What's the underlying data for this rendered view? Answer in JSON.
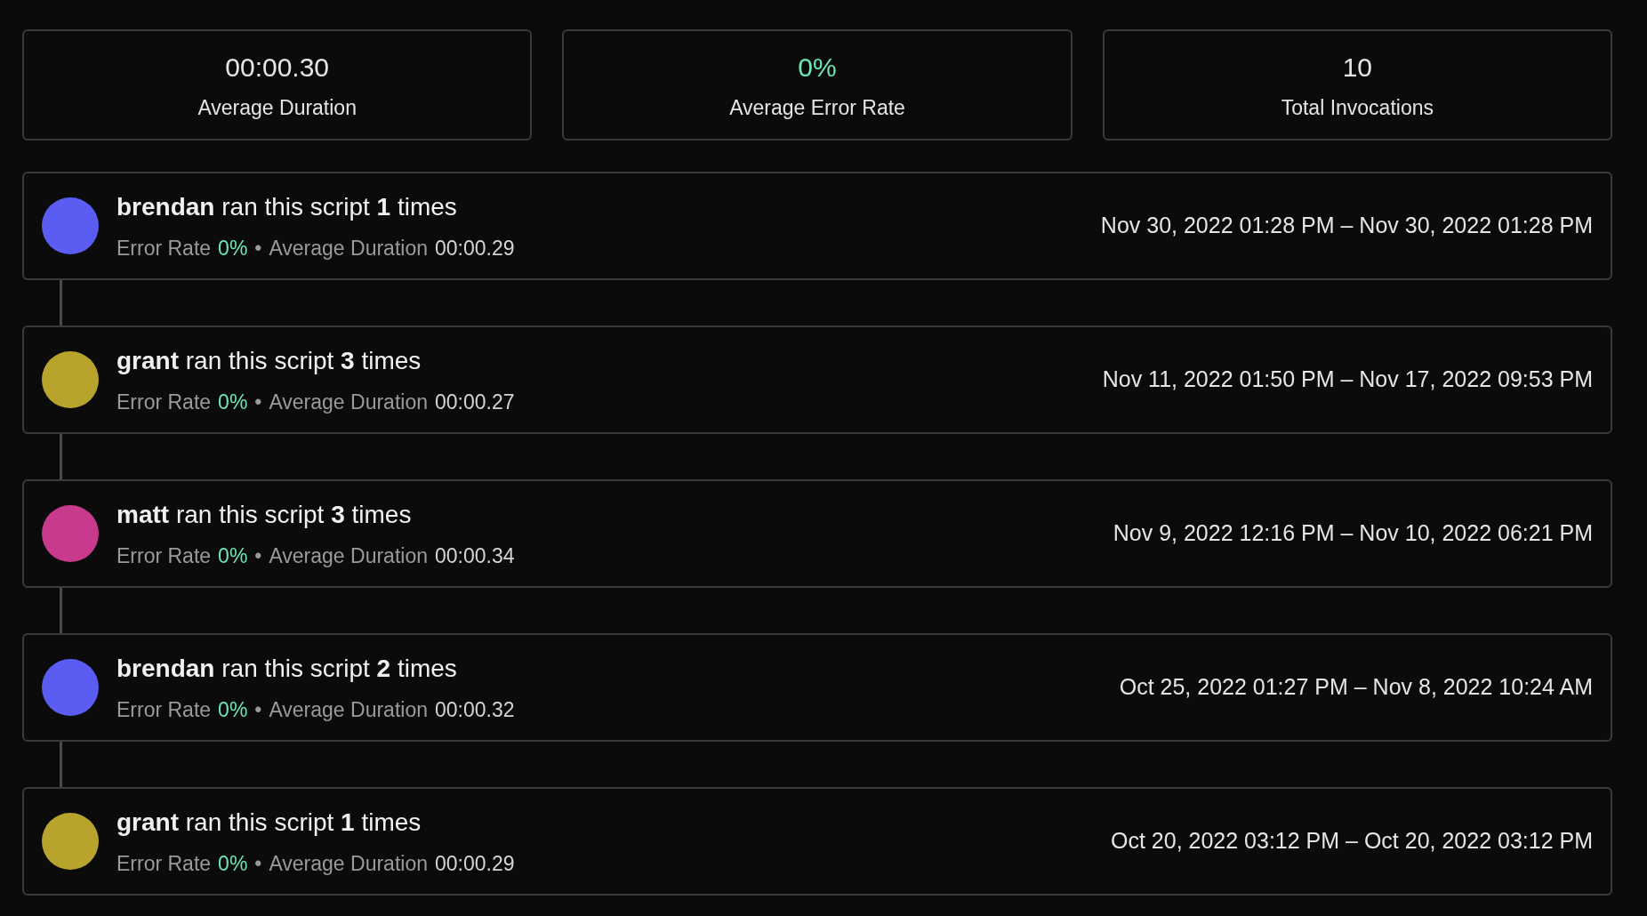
{
  "stats": [
    {
      "value": "00:00.30",
      "label": "Average Duration",
      "kind": "plain"
    },
    {
      "value": "0%",
      "label": "Average Error Rate",
      "kind": "success"
    },
    {
      "value": "10",
      "label": "Total Invocations",
      "kind": "plain"
    }
  ],
  "runs": [
    {
      "title": "**brendan** ran this script **1** times",
      "error_label": "Error Rate",
      "error_rate": "0%",
      "separator": "•",
      "duration_label": "Average Duration",
      "duration": "00:00.29",
      "range": "Nov 30, 2022 01:28 PM – Nov 30, 2022 01:28 PM",
      "color": "#5a5cf2"
    },
    {
      "title": "**grant** ran this script **3** times",
      "error_label": "Error Rate",
      "error_rate": "0%",
      "separator": "•",
      "duration_label": "Average Duration",
      "duration": "00:00.27",
      "range": "Nov 11, 2022 01:50 PM – Nov 17, 2022 09:53 PM",
      "color": "#b8a42c"
    },
    {
      "title": "**matt** ran this script **3** times",
      "error_label": "Error Rate",
      "error_rate": "0%",
      "separator": "•",
      "duration_label": "Average Duration",
      "duration": "00:00.34",
      "range": "Nov 9, 2022 12:16 PM – Nov 10, 2022 06:21 PM",
      "color": "#c83a8c"
    },
    {
      "title": "**brendan** ran this script **2** times",
      "error_label": "Error Rate",
      "error_rate": "0%",
      "separator": "•",
      "duration_label": "Average Duration",
      "duration": "00:00.32",
      "range": "Oct 25, 2022 01:27 PM – Nov 8, 2022 10:24 AM",
      "color": "#5a5cf2"
    },
    {
      "title": "**grant** ran this script **1** times",
      "error_label": "Error Rate",
      "error_rate": "0%",
      "separator": "•",
      "duration_label": "Average Duration",
      "duration": "00:00.29",
      "range": "Oct 20, 2022 03:12 PM – Oct 20, 2022 03:12 PM",
      "color": "#b8a42c"
    }
  ]
}
